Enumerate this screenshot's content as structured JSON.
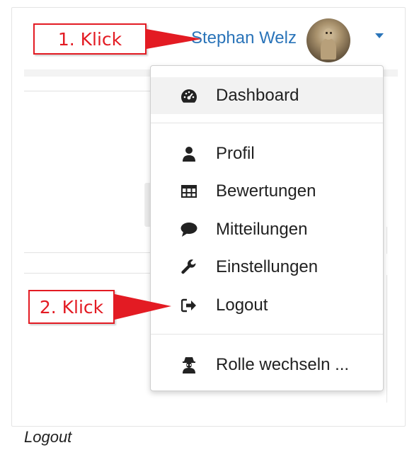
{
  "header": {
    "user_name": "Stephan Welz"
  },
  "callouts": {
    "first": "1. Klick",
    "second": "2. Klick"
  },
  "user_menu": {
    "items": [
      {
        "label": "Dashboard",
        "icon": "dashboard-icon"
      },
      {
        "label": "Profil",
        "icon": "user-icon"
      },
      {
        "label": "Bewertungen",
        "icon": "table-icon"
      },
      {
        "label": "Mitteilungen",
        "icon": "comment-icon"
      },
      {
        "label": "Einstellungen",
        "icon": "wrench-icon"
      },
      {
        "label": "Logout",
        "icon": "sign-out-icon"
      },
      {
        "label": "Rolle wechseln ...",
        "icon": "user-secret-icon"
      }
    ]
  },
  "caption": "Logout",
  "colors": {
    "link": "#2a74b9",
    "callout": "#e31b23",
    "menu_text": "#212121"
  }
}
